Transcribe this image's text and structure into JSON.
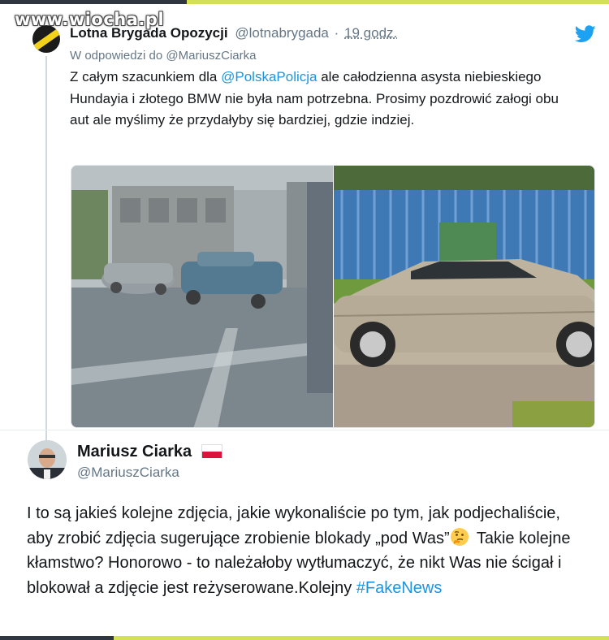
{
  "watermark": "www.wiocha.pl",
  "quoted_tweet": {
    "author_name": "Lotna Brygada Opozycji",
    "author_handle": "@lotnabrygada",
    "separator": "·",
    "time": "19 godz.",
    "reply_to": "W odpowiedzi do @MariuszCiarka",
    "text_before_mention": "Z całym szacunkiem dla ",
    "mention": "@PolskaPolicja",
    "text_after_mention": " ale całodzienna asysta niebieskiego Hundayia i złotego BMW nie była nam potrzebna. Prosimy pozdrowić załogi obu aut ale myślimy że przydałyby się bardziej, gdzie indziej.",
    "icons": [
      "twitter-bird-icon"
    ]
  },
  "main_tweet": {
    "author_name": "Mariusz Ciarka",
    "flag_icon": "poland-flag-icon",
    "author_handle": "@MariuszCiarka",
    "text_part1": "I to są jakieś kolejne zdjęcia, jakie wykonaliście po tym, jak podjechaliście, aby zrobić zdjęcia sugerujące zrobienie blokady „pod Was”",
    "emoji": "thinking-face-icon",
    "text_part2": " Takie kolejne kłamstwo? Honorowo - to należałoby wytłumaczyć, że nikt Was nie ścigał i blokował a zdjęcie jest reżyserowane.Kolejny ",
    "hashtag": "#FakeNews"
  },
  "colors": {
    "accent_link": "#1b95e0",
    "text_primary": "#14171a",
    "text_secondary": "#657786",
    "frame_lime": "#d4e157"
  }
}
